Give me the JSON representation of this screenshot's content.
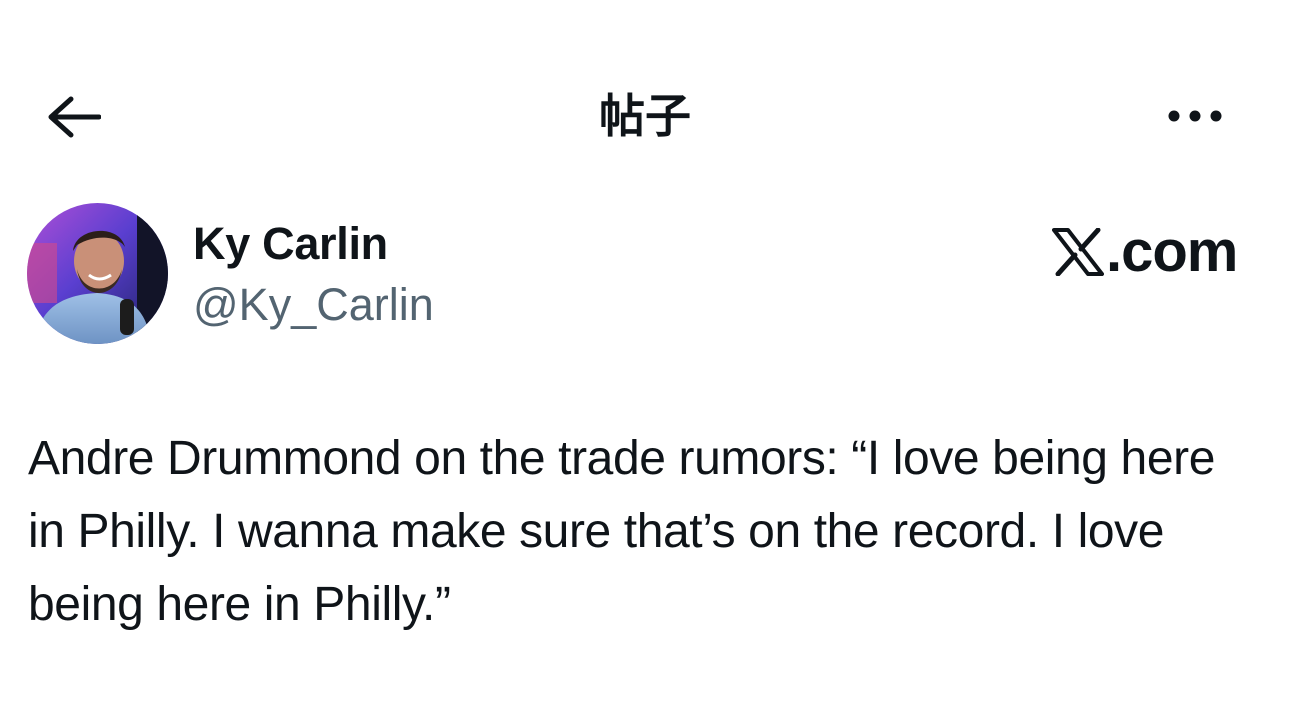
{
  "header": {
    "title": "帖子",
    "back_icon": "arrow-left-icon",
    "more_icon": "more-horizontal-icon"
  },
  "author": {
    "display_name": "Ky Carlin",
    "handle": "@Ky_Carlin"
  },
  "brand": {
    "logo_icon": "x-logo-icon",
    "text": ".com"
  },
  "tweet": {
    "text": "Andre Drummond on the trade rumors: “I love being here in Philly. I wanna make sure that’s on the record. I love being here in Philly.”"
  },
  "colors": {
    "text_primary": "#0f1419",
    "text_secondary": "#536471",
    "background": "#ffffff"
  }
}
